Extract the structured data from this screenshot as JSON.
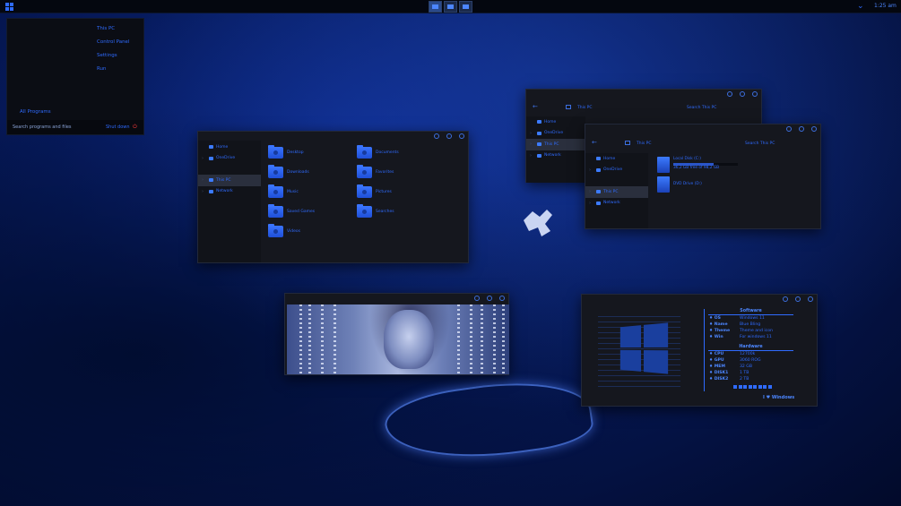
{
  "taskbar": {
    "time": "1:25 am"
  },
  "start_menu": {
    "links": [
      "This PC",
      "Control Panel",
      "Settings",
      "Run"
    ],
    "all_programs": "All Programs",
    "search_placeholder": "Search programs and files",
    "shutdown": "Shut down"
  },
  "explorer_main": {
    "nav": [
      "Home",
      "OneDrive",
      "This PC",
      "Network"
    ],
    "folders": [
      "Desktop",
      "Documents",
      "Downloads",
      "Favorites",
      "Music",
      "Pictures",
      "Saved Games",
      "Searches",
      "Videos"
    ]
  },
  "explorer_back": {
    "address": "This PC",
    "search": "Search This PC",
    "nav": [
      "Home",
      "OneDrive",
      "This PC",
      "Network"
    ]
  },
  "explorer_front": {
    "address": "This PC",
    "search": "Search This PC",
    "nav": [
      "Home",
      "OneDrive",
      "This PC",
      "Network"
    ],
    "drives": [
      {
        "name": "Local Disk (C:)",
        "free": "36,2 GB free of 98,2 GB",
        "used_fraction": 0.63
      },
      {
        "name": "DVD Drive (D:)"
      }
    ]
  },
  "sysinfo": {
    "software_title": "Software",
    "software": [
      {
        "key": "OS",
        "value": "Windows 11"
      },
      {
        "key": "Name",
        "value": "Blue Bling"
      },
      {
        "key": "Theme",
        "value": "Theme and icon"
      },
      {
        "key": "Win",
        "value": "For windows 11"
      }
    ],
    "hardware_title": "Hardware",
    "hardware": [
      {
        "key": "CPU",
        "value": "12700k"
      },
      {
        "key": "GPU",
        "value": "3060 ROG"
      },
      {
        "key": "MEM",
        "value": "32 GB"
      },
      {
        "key": "DISK1",
        "value": "1 TB"
      },
      {
        "key": "DISK2",
        "value": "2 TB"
      }
    ],
    "brand": "I ♥ Windows"
  },
  "colors": {
    "accent": "#2f6bff",
    "window_bg": "#15171e",
    "taskbar": "#04070f"
  }
}
